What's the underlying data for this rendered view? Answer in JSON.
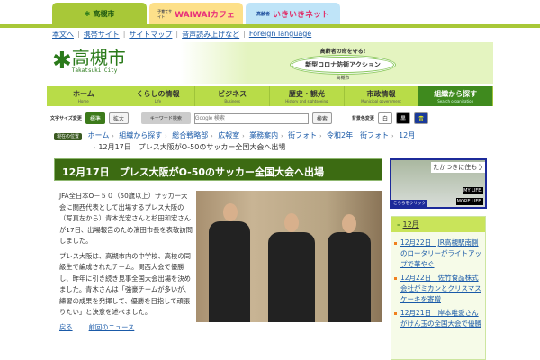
{
  "tabs": [
    {
      "label": "高槻市",
      "sub": "Takatsuki City"
    },
    {
      "label_small": "子育てサイト",
      "label": "WAIWAIカフェ"
    },
    {
      "label_small": "高齢者",
      "label": "いきいきネット"
    }
  ],
  "util_links": [
    "本文へ",
    "携帯サイト",
    "サイトマップ",
    "音声読み上げなど",
    "Foreign language"
  ],
  "logo": {
    "name": "高槻市",
    "sub": "Takatsuki City"
  },
  "campaign": {
    "top": "高齢者の命を守る!",
    "main": "新型コロナ防衛アクション",
    "bottom": "高槻市"
  },
  "nav": [
    {
      "label": "ホーム",
      "sub": "Home"
    },
    {
      "label": "くらしの情報",
      "sub": "Life"
    },
    {
      "label": "ビジネス",
      "sub": "Business"
    },
    {
      "label": "歴史・観光",
      "sub": "History and sightseeing"
    },
    {
      "label": "市政情報",
      "sub": "Municipal government"
    },
    {
      "label": "組織から探す",
      "sub": "Search organization"
    }
  ],
  "tools": {
    "font_label": "文字サイズ変更",
    "standard": "標準",
    "large": "拡大",
    "keyword_label": "キーワード検索",
    "search_placeholder": "Google 検索",
    "search_button": "検索",
    "bg_label": "背景色変更",
    "white": "白",
    "black": "黒",
    "blue": "青"
  },
  "breadcrumb": {
    "here": "現在の位置",
    "items": [
      "ホーム",
      "組織から探す",
      "総合戦略部",
      "広報室",
      "業務案内",
      "街フォト",
      "令和2年　街フォト",
      "12月"
    ],
    "current": "12月17日　プレス大阪がO-50のサッカー全国大会へ出場"
  },
  "article": {
    "title": "12月17日　プレス大阪がO-50のサッカー全国大会へ出場",
    "paragraphs": [
      "JFA全日本O－５０（50歳以上）サッカー大会に関西代表として出場するプレス大阪の（写真左から）青木光宏さんと杉田和宏さんが17日、出場報告のため濱田市長を表敬訪問しました。",
      "プレス大阪は、高槻市内の中学校、高校の同級生で編成されたチーム。関西大会で優勝し、昨年に引き続き見事全国大会出場を決めました。青木さんは「強豪チームが多いが、練習の成果を発揮して、優勝を目指して頑張りたい」と決意を述べました。"
    ],
    "back": "戻る",
    "prev": "前回のニュース"
  },
  "banner": {
    "title": "たかつきに住もう",
    "click": "こちらをクリック",
    "my": "MY LIFE.",
    "more": "MORE LIFE."
  },
  "sidebar": {
    "month": "12月",
    "items": [
      "12月22日　JR高槻駅南側のロータリーがライトアップで華やぐ",
      "12月22日　佐竹食品株式会社がミカンとクリスマスケーキを寄贈",
      "12月21日　岸本唯愛さんがけん玉の全国大会で優勝"
    ]
  }
}
